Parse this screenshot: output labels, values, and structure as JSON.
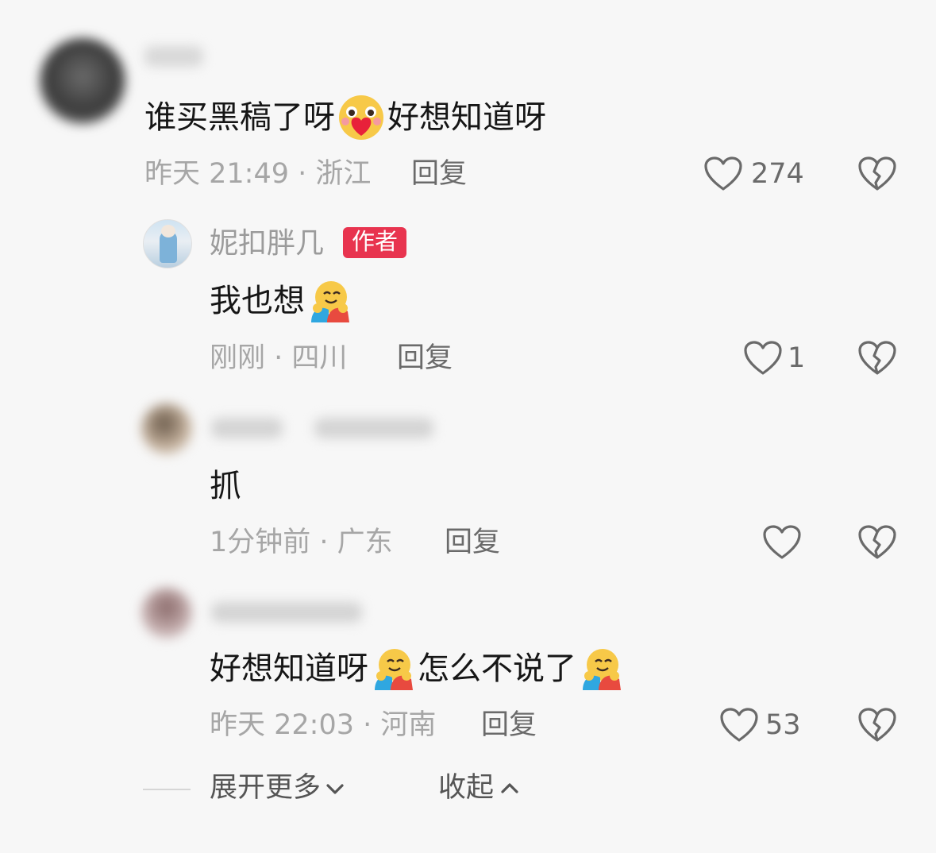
{
  "comments": [
    {
      "text_a": "谁买黑稿了呀",
      "emoji_a": "red-heart-face-emoji",
      "text_b": "好想知道呀",
      "time": "昨天 21:49",
      "region": "浙江",
      "reply_label": "回复",
      "likes": "274"
    }
  ],
  "replies": [
    {
      "username": "妮扣胖几",
      "badge": "作者",
      "text_a": "我也想",
      "emoji_a": "hugging-face-emoji",
      "time": "刚刚",
      "region": "四川",
      "reply_label": "回复",
      "likes": "1"
    },
    {
      "text_a": "抓",
      "time": "1分钟前",
      "region": "广东",
      "reply_label": "回复",
      "likes": ""
    },
    {
      "text_a": "好想知道呀",
      "emoji_a": "hugging-face-emoji",
      "text_b": "怎么不说了",
      "emoji_b": "hugging-face-emoji",
      "time": "昨天 22:03",
      "region": "河南",
      "reply_label": "回复",
      "likes": "53"
    }
  ],
  "footer": {
    "expand_label": "展开更多",
    "collapse_label": "收起"
  },
  "icons": {
    "like": "heart-outline-icon",
    "dislike": "broken-heart-icon",
    "expand": "chevron-down-icon",
    "collapse": "chevron-up-icon"
  },
  "colors": {
    "author_badge": "#e8344f",
    "meta_text": "#a6a6a6",
    "action_text": "#6a6a6a"
  }
}
